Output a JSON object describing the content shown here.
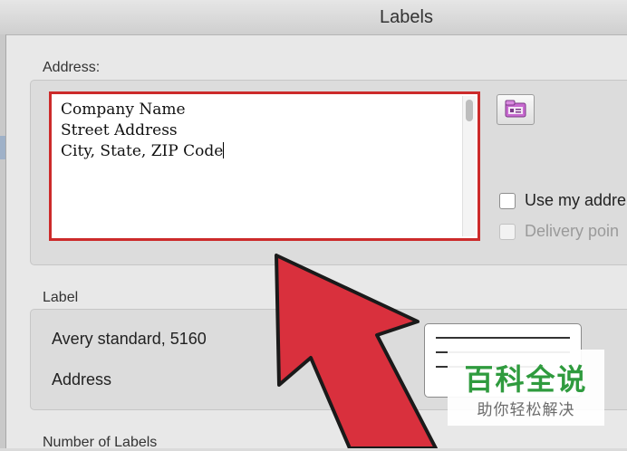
{
  "window": {
    "title": "Labels"
  },
  "address": {
    "section_label": "Address:",
    "lines": [
      "Company Name",
      "Street Address",
      "City, State, ZIP Code"
    ],
    "use_my_address_label": "Use my addre",
    "delivery_point_label": "Delivery poin"
  },
  "label": {
    "section_label": "Label",
    "product": "Avery standard, 5160",
    "type": "Address"
  },
  "number_of_labels": {
    "section_label": "Number of Labels"
  },
  "watermark": {
    "title": "百科全说",
    "subtitle": "助你轻松解决"
  },
  "colors": {
    "highlight_red": "#cc2a2a",
    "arrow_red": "#d9303d",
    "watermark_green": "#2f9b3e"
  },
  "icons": {
    "address_book": "address-book-icon"
  }
}
